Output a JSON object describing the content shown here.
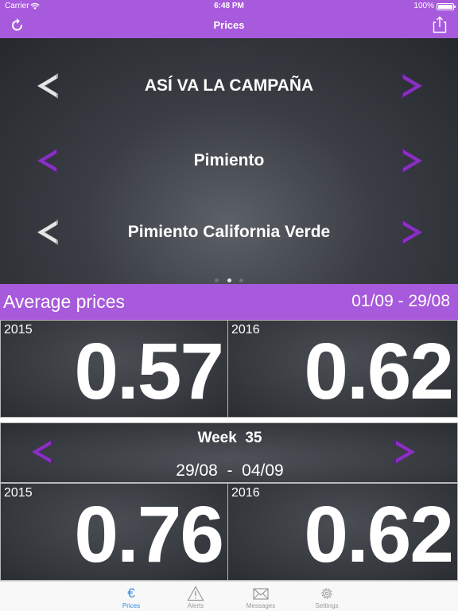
{
  "status_bar": {
    "carrier": "Carrier",
    "time": "6:48 PM",
    "battery": "100%"
  },
  "nav": {
    "title": "Prices",
    "left_icon": "refresh-icon",
    "right_icon": "share-icon"
  },
  "selector": {
    "rows": [
      {
        "label": "ASÍ VA LA CAMPAÑA",
        "left_enabled": false,
        "right_enabled": true
      },
      {
        "label": "Pimiento",
        "left_enabled": true,
        "right_enabled": true
      },
      {
        "label": "Pimiento California Verde",
        "left_enabled": false,
        "right_enabled": true
      }
    ],
    "page_dots": 3,
    "active_dot": 1
  },
  "average": {
    "title": "Average prices",
    "range": "01/09 - 29/08",
    "prices": [
      {
        "year": "2015",
        "value": "0.57"
      },
      {
        "year": "2016",
        "value": "0.62"
      }
    ]
  },
  "week": {
    "label": "Week  35",
    "range": "29/08  -  04/09",
    "prices": [
      {
        "year": "2015",
        "value": "0.76"
      },
      {
        "year": "2016",
        "value": "0.62"
      }
    ]
  },
  "tabs": [
    {
      "label": "Prices",
      "icon": "euro-icon",
      "active": true
    },
    {
      "label": "Alerts",
      "icon": "warning-icon",
      "active": false
    },
    {
      "label": "Messages",
      "icon": "envelope-icon",
      "active": false
    },
    {
      "label": "Settings",
      "icon": "gear-icon",
      "active": false
    }
  ],
  "colors": {
    "accent": "#a75adb",
    "arrow_active": "#8a2fc4",
    "arrow_disabled": "#c8c8c8",
    "tab_active": "#2f8ce6"
  }
}
